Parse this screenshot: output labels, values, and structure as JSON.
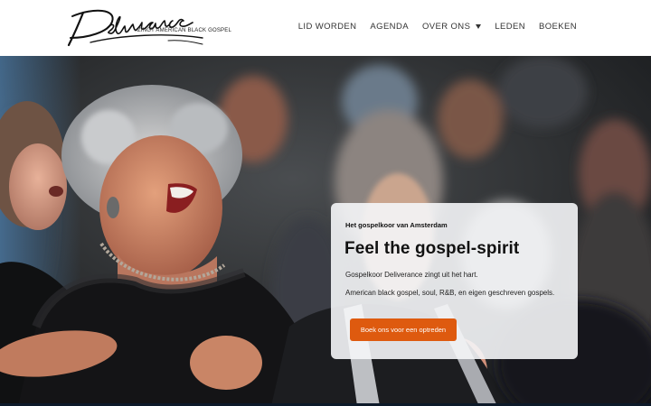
{
  "logo": {
    "wordmark": "Deliverance",
    "tagline": "ZINGT AMERICAN BLACK GOSPEL"
  },
  "nav": {
    "items": [
      {
        "label": "LID WORDEN"
      },
      {
        "label": "AGENDA"
      },
      {
        "label": "OVER ONS",
        "has_dropdown": true
      },
      {
        "label": "LEDEN"
      },
      {
        "label": "BOEKEN"
      }
    ]
  },
  "hero": {
    "eyebrow": "Het gospelkoor van Amsterdam",
    "title": "Feel the gospel-spirit",
    "line1": "Gospelkoor Deliverance zingt uit het hart.",
    "line2": "American black gospel, soul, R&B, en eigen geschreven gospels.",
    "cta_label": "Boek ons voor een optreden"
  },
  "colors": {
    "accent": "#de5a0f",
    "header_bg": "#ffffff",
    "card_bg": "#f5f6f8"
  },
  "icons": {
    "dropdown": "chevron-down-icon"
  }
}
